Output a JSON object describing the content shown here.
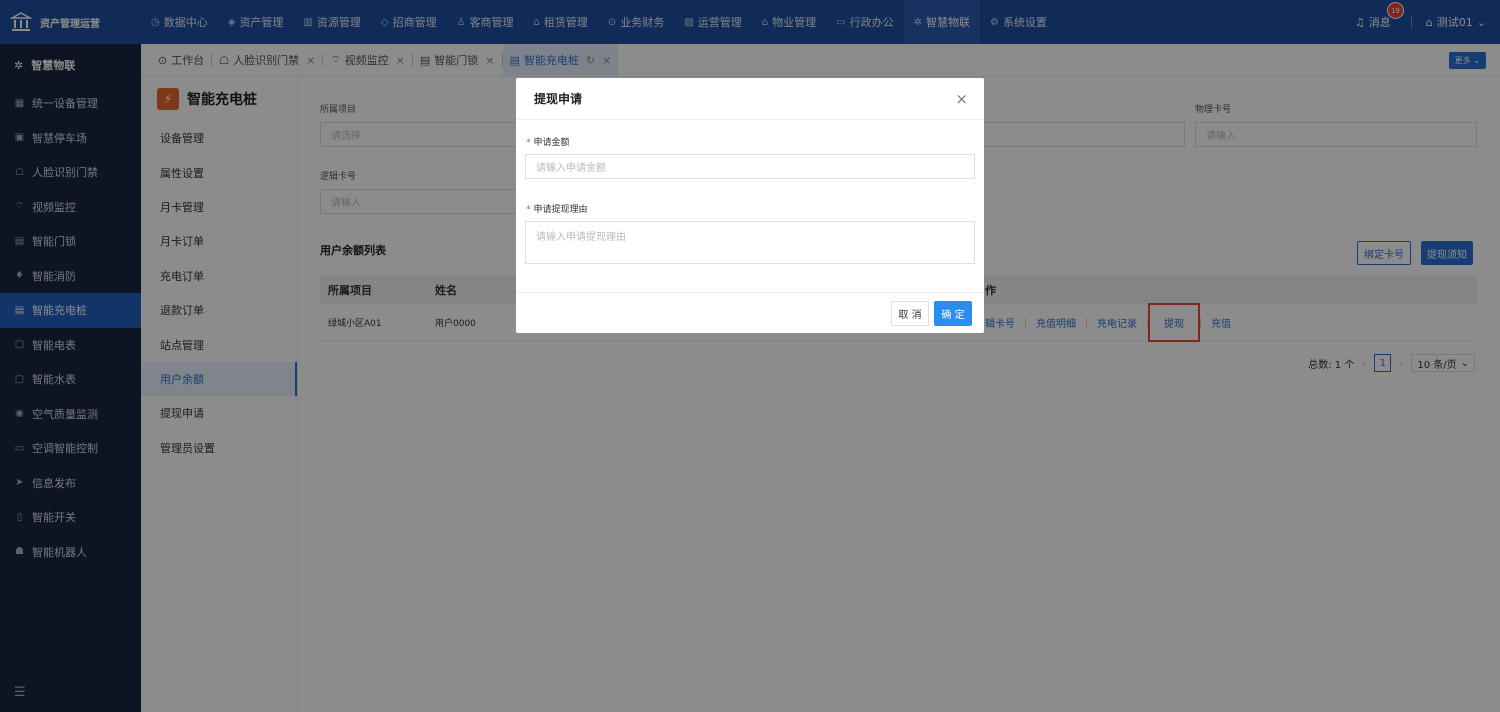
{
  "brand": {
    "name": "资产管理运营"
  },
  "topnav": [
    {
      "label": "数据中心",
      "icon": "clock-icon"
    },
    {
      "label": "资产管理",
      "icon": "cube-icon"
    },
    {
      "label": "资源管理",
      "icon": "building-icon"
    },
    {
      "label": "招商管理",
      "icon": "diamond-icon"
    },
    {
      "label": "客商管理",
      "icon": "people-icon"
    },
    {
      "label": "租赁管理",
      "icon": "house-icon"
    },
    {
      "label": "业务财务",
      "icon": "coin-icon"
    },
    {
      "label": "运营管理",
      "icon": "chart-icon"
    },
    {
      "label": "物业管理",
      "icon": "home-icon"
    },
    {
      "label": "行政办公",
      "icon": "monitor-icon"
    },
    {
      "label": "智慧物联",
      "icon": "iot-icon"
    },
    {
      "label": "系统设置",
      "icon": "settings-icon"
    }
  ],
  "topbar": {
    "messages_label": "消息",
    "messages_count": "19",
    "user_label": "测试01"
  },
  "sidebar": {
    "header": "智慧物联",
    "items": [
      {
        "label": "统一设备管理"
      },
      {
        "label": "智慧停车场"
      },
      {
        "label": "人脸识别门禁"
      },
      {
        "label": "视频监控"
      },
      {
        "label": "智能门锁"
      },
      {
        "label": "智能消防"
      },
      {
        "label": "智能充电桩"
      },
      {
        "label": "智能电表"
      },
      {
        "label": "智能水表"
      },
      {
        "label": "空气质量监测"
      },
      {
        "label": "空调智能控制"
      },
      {
        "label": "信息发布"
      },
      {
        "label": "智能开关"
      },
      {
        "label": "智能机器人"
      }
    ],
    "active_index": 6
  },
  "tabs": [
    {
      "label": "工作台"
    },
    {
      "label": "人脸识别门禁"
    },
    {
      "label": "视频监控"
    },
    {
      "label": "智能门锁"
    },
    {
      "label": "智能充电桩"
    }
  ],
  "more_label": "更多",
  "subpanel": {
    "title": "智能充电桩",
    "items": [
      {
        "label": "设备管理"
      },
      {
        "label": "属性设置"
      },
      {
        "label": "月卡管理"
      },
      {
        "label": "月卡订单"
      },
      {
        "label": "充电订单"
      },
      {
        "label": "退款订单"
      },
      {
        "label": "站点管理"
      },
      {
        "label": "用户余额"
      },
      {
        "label": "提现申请"
      },
      {
        "label": "管理员设置"
      }
    ],
    "active_index": 7
  },
  "filters": {
    "project_label": "所属项目",
    "project_placeholder": "请选择",
    "physical_card_label": "物理卡号",
    "physical_card_placeholder": "请输入",
    "logical_card_label": "逻辑卡号",
    "logical_card_placeholder": "请输入"
  },
  "list": {
    "title": "用户余额列表",
    "bind_card_button": "绑定卡号",
    "withdraw_notice_button": "提现须知",
    "columns": [
      "所属项目",
      "姓名",
      "作"
    ],
    "rows": [
      {
        "project": "绿城小区A01",
        "name": "用户0000"
      }
    ],
    "ops": [
      "辑卡号",
      "充值明细",
      "充电记录",
      "提现",
      "充值"
    ]
  },
  "pagination": {
    "total": "总数: 1 个",
    "current_page": "1",
    "page_size": "10 条/页"
  },
  "modal": {
    "title": "提现申请",
    "amount_label": "申请金额",
    "amount_placeholder": "请输入申请金额",
    "reason_label": "申请提现理由",
    "reason_placeholder": "请输入申请提现理由",
    "cancel_label": "取 消",
    "ok_label": "确 定"
  },
  "colors": {
    "topbar": "#1f4fa0",
    "sidebar": "#18263f",
    "accent": "#2a6fd6",
    "highlight": "#e8483a"
  }
}
